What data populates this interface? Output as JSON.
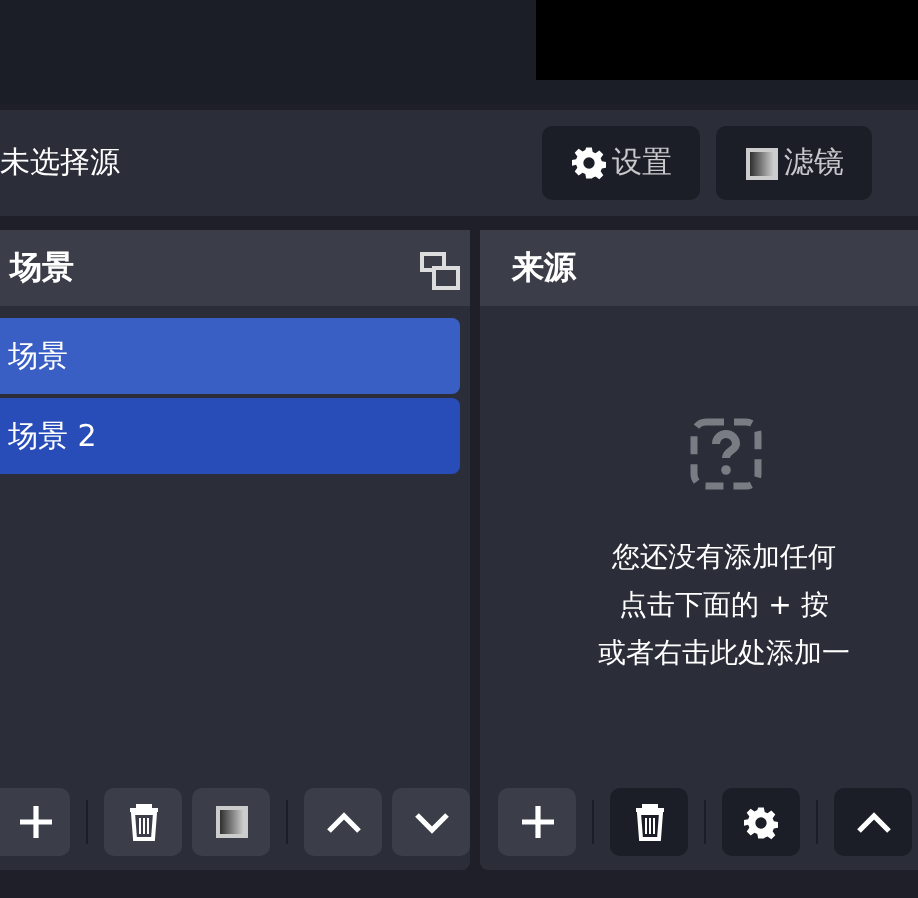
{
  "source_bar": {
    "label": "未选择源",
    "buttons": [
      {
        "kind": "settings",
        "label": "设置"
      },
      {
        "kind": "filters",
        "label": "滤镜"
      }
    ]
  },
  "scenes": {
    "title": "场景",
    "items": [
      {
        "label": "场景",
        "selected": true,
        "hovered": true
      },
      {
        "label": "场景 2",
        "selected": true,
        "hovered": false
      }
    ],
    "toolbar": [
      {
        "kind": "add",
        "disabled": false
      },
      {
        "kind": "remove",
        "disabled": false
      },
      {
        "kind": "filters",
        "disabled": false
      },
      {
        "kind": "up",
        "disabled": false
      },
      {
        "kind": "down",
        "disabled": false
      }
    ]
  },
  "sources": {
    "title": "来源",
    "empty_message": [
      "您还没有添加任何",
      "点击下面的 + 按",
      "或者右击此处添加一"
    ],
    "toolbar": [
      {
        "kind": "add",
        "disabled": false
      },
      {
        "kind": "remove",
        "disabled": true
      },
      {
        "kind": "settings",
        "disabled": true
      },
      {
        "kind": "up",
        "disabled": true
      }
    ]
  }
}
